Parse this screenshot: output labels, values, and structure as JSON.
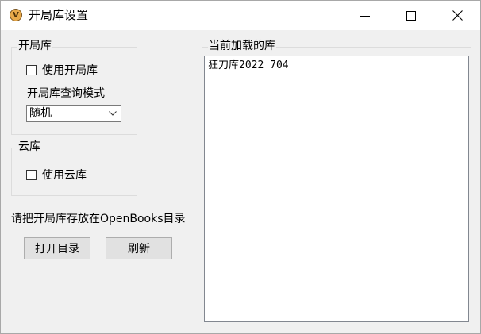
{
  "window": {
    "title": "开局库设置",
    "app_icon_glyph": "V",
    "controls": {
      "minimize": "minimize-icon",
      "maximize": "maximize-icon",
      "close": "close-icon"
    }
  },
  "opening_group": {
    "label": "开局库",
    "use_checkbox_label": "使用开局库",
    "use_checked": false,
    "query_mode_label": "开局库查询模式",
    "query_mode_value": "随机"
  },
  "cloud_group": {
    "label": "云库",
    "use_checkbox_label": "使用云库",
    "use_checked": false
  },
  "hint": "请把开局库存放在OpenBooks目录",
  "buttons": {
    "open_dir": "打开目录",
    "refresh": "刷新"
  },
  "loaded": {
    "label": "当前加载的库",
    "items": [
      "狂刀库2022 704"
    ]
  },
  "colors": {
    "background": "#f0f0f0",
    "titlebar": "#ffffff",
    "button": "#e1e1e1"
  }
}
